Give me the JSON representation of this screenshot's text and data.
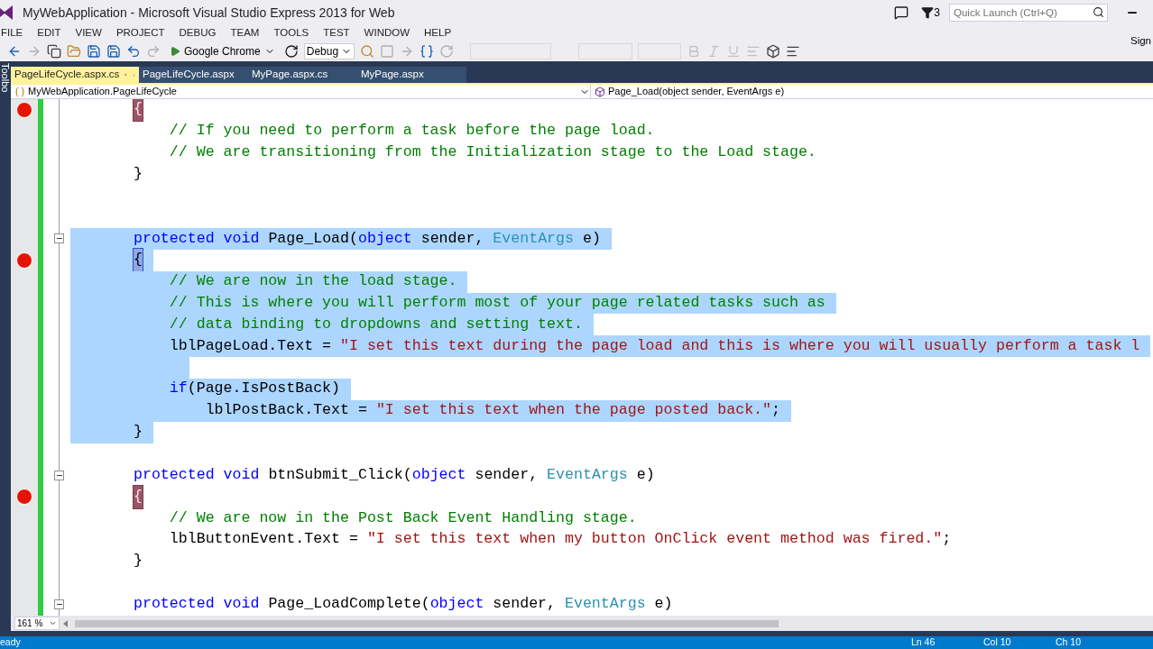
{
  "window": {
    "title": "MyWebApplication - Microsoft Visual Studio Express 2013 for Web",
    "notifications": "3",
    "quick_launch": {
      "placeholder": "Quick Launch (Ctrl+Q)"
    },
    "sign_in": "Sign"
  },
  "menu": [
    "FILE",
    "EDIT",
    "VIEW",
    "PROJECT",
    "DEBUG",
    "TEAM",
    "TOOLS",
    "TEST",
    "WINDOW",
    "HELP"
  ],
  "toolbar": {
    "browser": "Google Chrome",
    "configuration": "Debug"
  },
  "side_panel": "Toolbo",
  "tabs": [
    {
      "label": "PageLifeCycle.aspx.cs",
      "selected": true
    },
    {
      "label": "PageLifeCycle.aspx",
      "selected": false
    },
    {
      "label": "MyPage.aspx.cs",
      "selected": false
    },
    {
      "label": "MyPage.aspx",
      "selected": false
    }
  ],
  "navigation": {
    "type": "MyWebApplication.PageLifeCycle",
    "member": "Page_Load(object sender, EventArgs e)"
  },
  "code_lines": [
    {
      "breakpoint": true,
      "fold": false,
      "selected": false,
      "tokens": [
        {
          "kind": "bp_brace",
          "text": "{"
        }
      ]
    },
    {
      "breakpoint": false,
      "fold": false,
      "selected": false,
      "tokens": [
        {
          "kind": "comment",
          "text": "    // If you need to perform a task before the page load."
        }
      ]
    },
    {
      "breakpoint": false,
      "fold": false,
      "selected": false,
      "tokens": [
        {
          "kind": "comment",
          "text": "    // We are transitioning from the Initialization stage to the Load stage."
        }
      ]
    },
    {
      "breakpoint": false,
      "fold": false,
      "selected": false,
      "tokens": [
        {
          "kind": "plain",
          "text": "}"
        }
      ]
    },
    {
      "breakpoint": false,
      "fold": false,
      "selected": false
    },
    {
      "breakpoint": false,
      "fold": false,
      "selected": false
    },
    {
      "breakpoint": false,
      "fold": true,
      "selected": true,
      "tokens": [
        {
          "kind": "keyword",
          "text": "protected void"
        },
        {
          "kind": "plain",
          "text": " Page_Load("
        },
        {
          "kind": "keyword",
          "text": "object"
        },
        {
          "kind": "plain",
          "text": " sender, "
        },
        {
          "kind": "type",
          "text": "EventArgs"
        },
        {
          "kind": "plain",
          "text": " e)"
        }
      ]
    },
    {
      "breakpoint": true,
      "fold": false,
      "selected": true,
      "tokens": [
        {
          "kind": "match_brace",
          "text": "{"
        }
      ]
    },
    {
      "breakpoint": false,
      "fold": false,
      "selected": true,
      "tokens": [
        {
          "kind": "comment",
          "text": "    // We are now in the load stage."
        }
      ]
    },
    {
      "breakpoint": false,
      "fold": false,
      "selected": true,
      "tokens": [
        {
          "kind": "comment",
          "text": "    // This is where you will perform most of your page related tasks such as"
        }
      ]
    },
    {
      "breakpoint": false,
      "fold": false,
      "selected": true,
      "tokens": [
        {
          "kind": "comment",
          "text": "    // data binding to dropdowns and setting text."
        }
      ]
    },
    {
      "breakpoint": false,
      "fold": false,
      "selected": true,
      "tokens": [
        {
          "kind": "plain",
          "text": "    lblPageLoad.Text = "
        },
        {
          "kind": "string",
          "text": "\"I set this text during the page load and this is where you will usually perform a task l"
        }
      ]
    },
    {
      "breakpoint": false,
      "fold": false,
      "selected": true
    },
    {
      "breakpoint": false,
      "fold": false,
      "selected": true,
      "tokens": [
        {
          "kind": "keyword",
          "text": "    if"
        },
        {
          "kind": "plain",
          "text": "(Page.IsPostBack)"
        }
      ]
    },
    {
      "breakpoint": false,
      "fold": false,
      "selected": true,
      "tokens": [
        {
          "kind": "plain",
          "text": "        lblPostBack.Text = "
        },
        {
          "kind": "string",
          "text": "\"I set this text when the page posted back.\""
        },
        {
          "kind": "plain",
          "text": ";"
        }
      ]
    },
    {
      "breakpoint": false,
      "fold": false,
      "selected": true,
      "tokens": [
        {
          "kind": "plain",
          "text": "}"
        }
      ]
    },
    {
      "breakpoint": false,
      "fold": false,
      "selected": false
    },
    {
      "breakpoint": false,
      "fold": true,
      "selected": false,
      "tokens": [
        {
          "kind": "keyword",
          "text": "protected void"
        },
        {
          "kind": "plain",
          "text": " btnSubmit_Click("
        },
        {
          "kind": "keyword",
          "text": "object"
        },
        {
          "kind": "plain",
          "text": " sender, "
        },
        {
          "kind": "type",
          "text": "EventArgs"
        },
        {
          "kind": "plain",
          "text": " e)"
        }
      ]
    },
    {
      "breakpoint": true,
      "fold": false,
      "selected": false,
      "tokens": [
        {
          "kind": "bp_brace",
          "text": "{"
        }
      ]
    },
    {
      "breakpoint": false,
      "fold": false,
      "selected": false,
      "tokens": [
        {
          "kind": "comment",
          "text": "    // We are now in the Post Back Event Handling stage."
        }
      ]
    },
    {
      "breakpoint": false,
      "fold": false,
      "selected": false,
      "tokens": [
        {
          "kind": "plain",
          "text": "    lblButtonEvent.Text = "
        },
        {
          "kind": "string",
          "text": "\"I set this text when my button OnClick event method was fired.\""
        },
        {
          "kind": "plain",
          "text": ";"
        }
      ]
    },
    {
      "breakpoint": false,
      "fold": false,
      "selected": false,
      "tokens": [
        {
          "kind": "plain",
          "text": "}"
        }
      ]
    },
    {
      "breakpoint": false,
      "fold": false,
      "selected": false
    },
    {
      "breakpoint": false,
      "fold": true,
      "selected": false,
      "tokens": [
        {
          "kind": "keyword",
          "text": "protected void"
        },
        {
          "kind": "plain",
          "text": " Page_LoadComplete("
        },
        {
          "kind": "keyword",
          "text": "object"
        },
        {
          "kind": "plain",
          "text": " sender, "
        },
        {
          "kind": "type",
          "text": "EventArgs"
        },
        {
          "kind": "plain",
          "text": " e)"
        }
      ]
    }
  ],
  "zoom": "161 %",
  "status_bar": {
    "message": "eady",
    "line": "Ln 46",
    "column": "Col 10",
    "char": "Ch 10"
  }
}
